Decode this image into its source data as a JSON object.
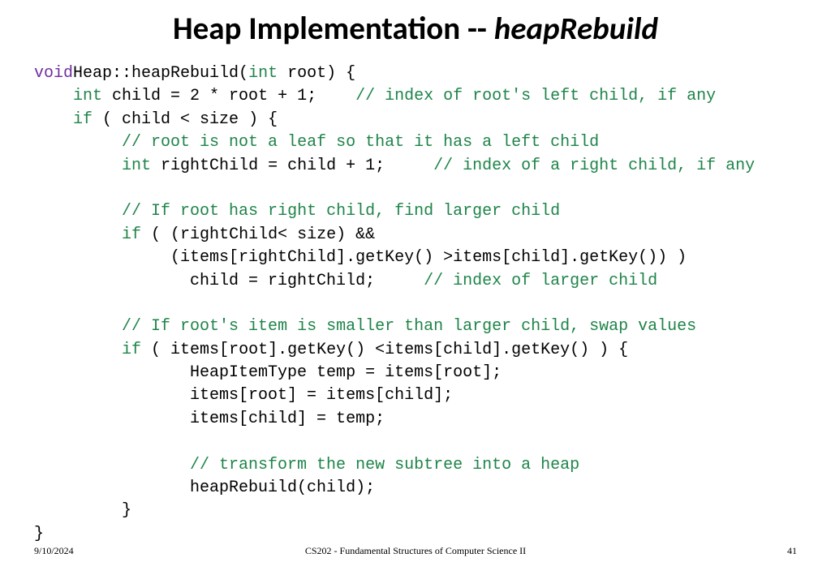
{
  "title": {
    "part1": "Heap Implementation -- ",
    "part2": "heapRebuild"
  },
  "code": {
    "l01_kw": "void",
    "l01_rest": "Heap::heapRebuild(",
    "l01_type": "int",
    "l01_tail": " root) {",
    "l02_ind": "    ",
    "l02_type": "int",
    "l02_body": " child = 2 * root + 1;    ",
    "l02_cmt": "// index of root's left child, if any",
    "l03_ind": "    ",
    "l03_if": "if",
    "l03_body": " ( child < size ) {",
    "l04_ind": "         ",
    "l04_cmt": "// root is not a leaf so that it has a left child",
    "l05_ind": "         ",
    "l05_type": "int",
    "l05_body": " rightChild = child + 1;     ",
    "l05_cmt": "// index of a right child, if any",
    "l06_ind": "         ",
    "l06_cmt": "// If root has right child, find larger child",
    "l07_ind": "         ",
    "l07_if": "if",
    "l07_body": " ( (rightChild< size) &&",
    "l08": "              (items[rightChild].getKey() >items[child].getKey()) )",
    "l09_body": "                child = rightChild;     ",
    "l09_cmt": "// index of larger child",
    "l10_ind": "         ",
    "l10_cmt": "// If root's item is smaller than larger child, swap values",
    "l11_ind": "         ",
    "l11_if": "if",
    "l11_body": " ( items[root].getKey() <items[child].getKey() ) {",
    "l12": "                HeapItemType temp = items[root];",
    "l13": "                items[root] = items[child];",
    "l14": "                items[child] = temp;",
    "l15_ind": "                ",
    "l15_cmt": "// transform the new subtree into a heap",
    "l16": "                heapRebuild(child);",
    "l17": "         }",
    "l18": "}"
  },
  "footer": {
    "date": "9/10/2024",
    "course": "CS202 - Fundamental Structures of Computer Science II",
    "page": "41"
  }
}
